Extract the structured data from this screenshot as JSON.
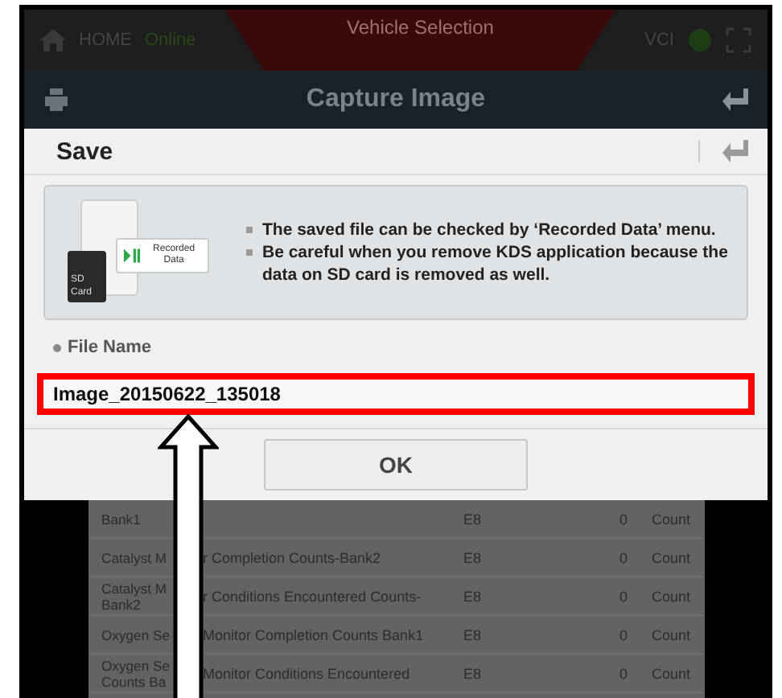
{
  "status_bar": {
    "home": "HOME",
    "connection": "Online",
    "vehicle_selection": "Vehicle Selection",
    "vci": "VCI"
  },
  "header": {
    "title": "Capture Image"
  },
  "dialog": {
    "title": "Save",
    "notes": [
      "The saved file can be checked by ‘Recorded Data’ menu.",
      "Be careful when you remove KDS application because the data on SD card is removed as well."
    ],
    "illustration": {
      "badge_label": "Recorded Data",
      "sd_label": "SD Card"
    },
    "file_name_label": "File Name",
    "file_name": "Image_20150622_135018",
    "highlighted": true,
    "ok_button": "OK"
  },
  "table": {
    "rows": [
      {
        "name_left": "Bank1",
        "name_right": "",
        "code": "E8",
        "value": "0",
        "unit": "Count"
      },
      {
        "name_left": "Catalyst M",
        "name_right": "r Completion Counts-Bank2",
        "code": "E8",
        "value": "0",
        "unit": "Count"
      },
      {
        "name_left": "Catalyst M\nBank2",
        "name_right": "r Conditions Encountered Counts-",
        "code": "E8",
        "value": "0",
        "unit": "Count"
      },
      {
        "name_left": "Oxygen Se",
        "name_right": "Monitor Completion Counts Bank1",
        "code": "E8",
        "value": "0",
        "unit": "Count"
      },
      {
        "name_left": "Oxygen Se\nCounts Ba",
        "name_right": "Monitor Conditions Encountered",
        "code": "E8",
        "value": "0",
        "unit": "Count"
      }
    ]
  }
}
